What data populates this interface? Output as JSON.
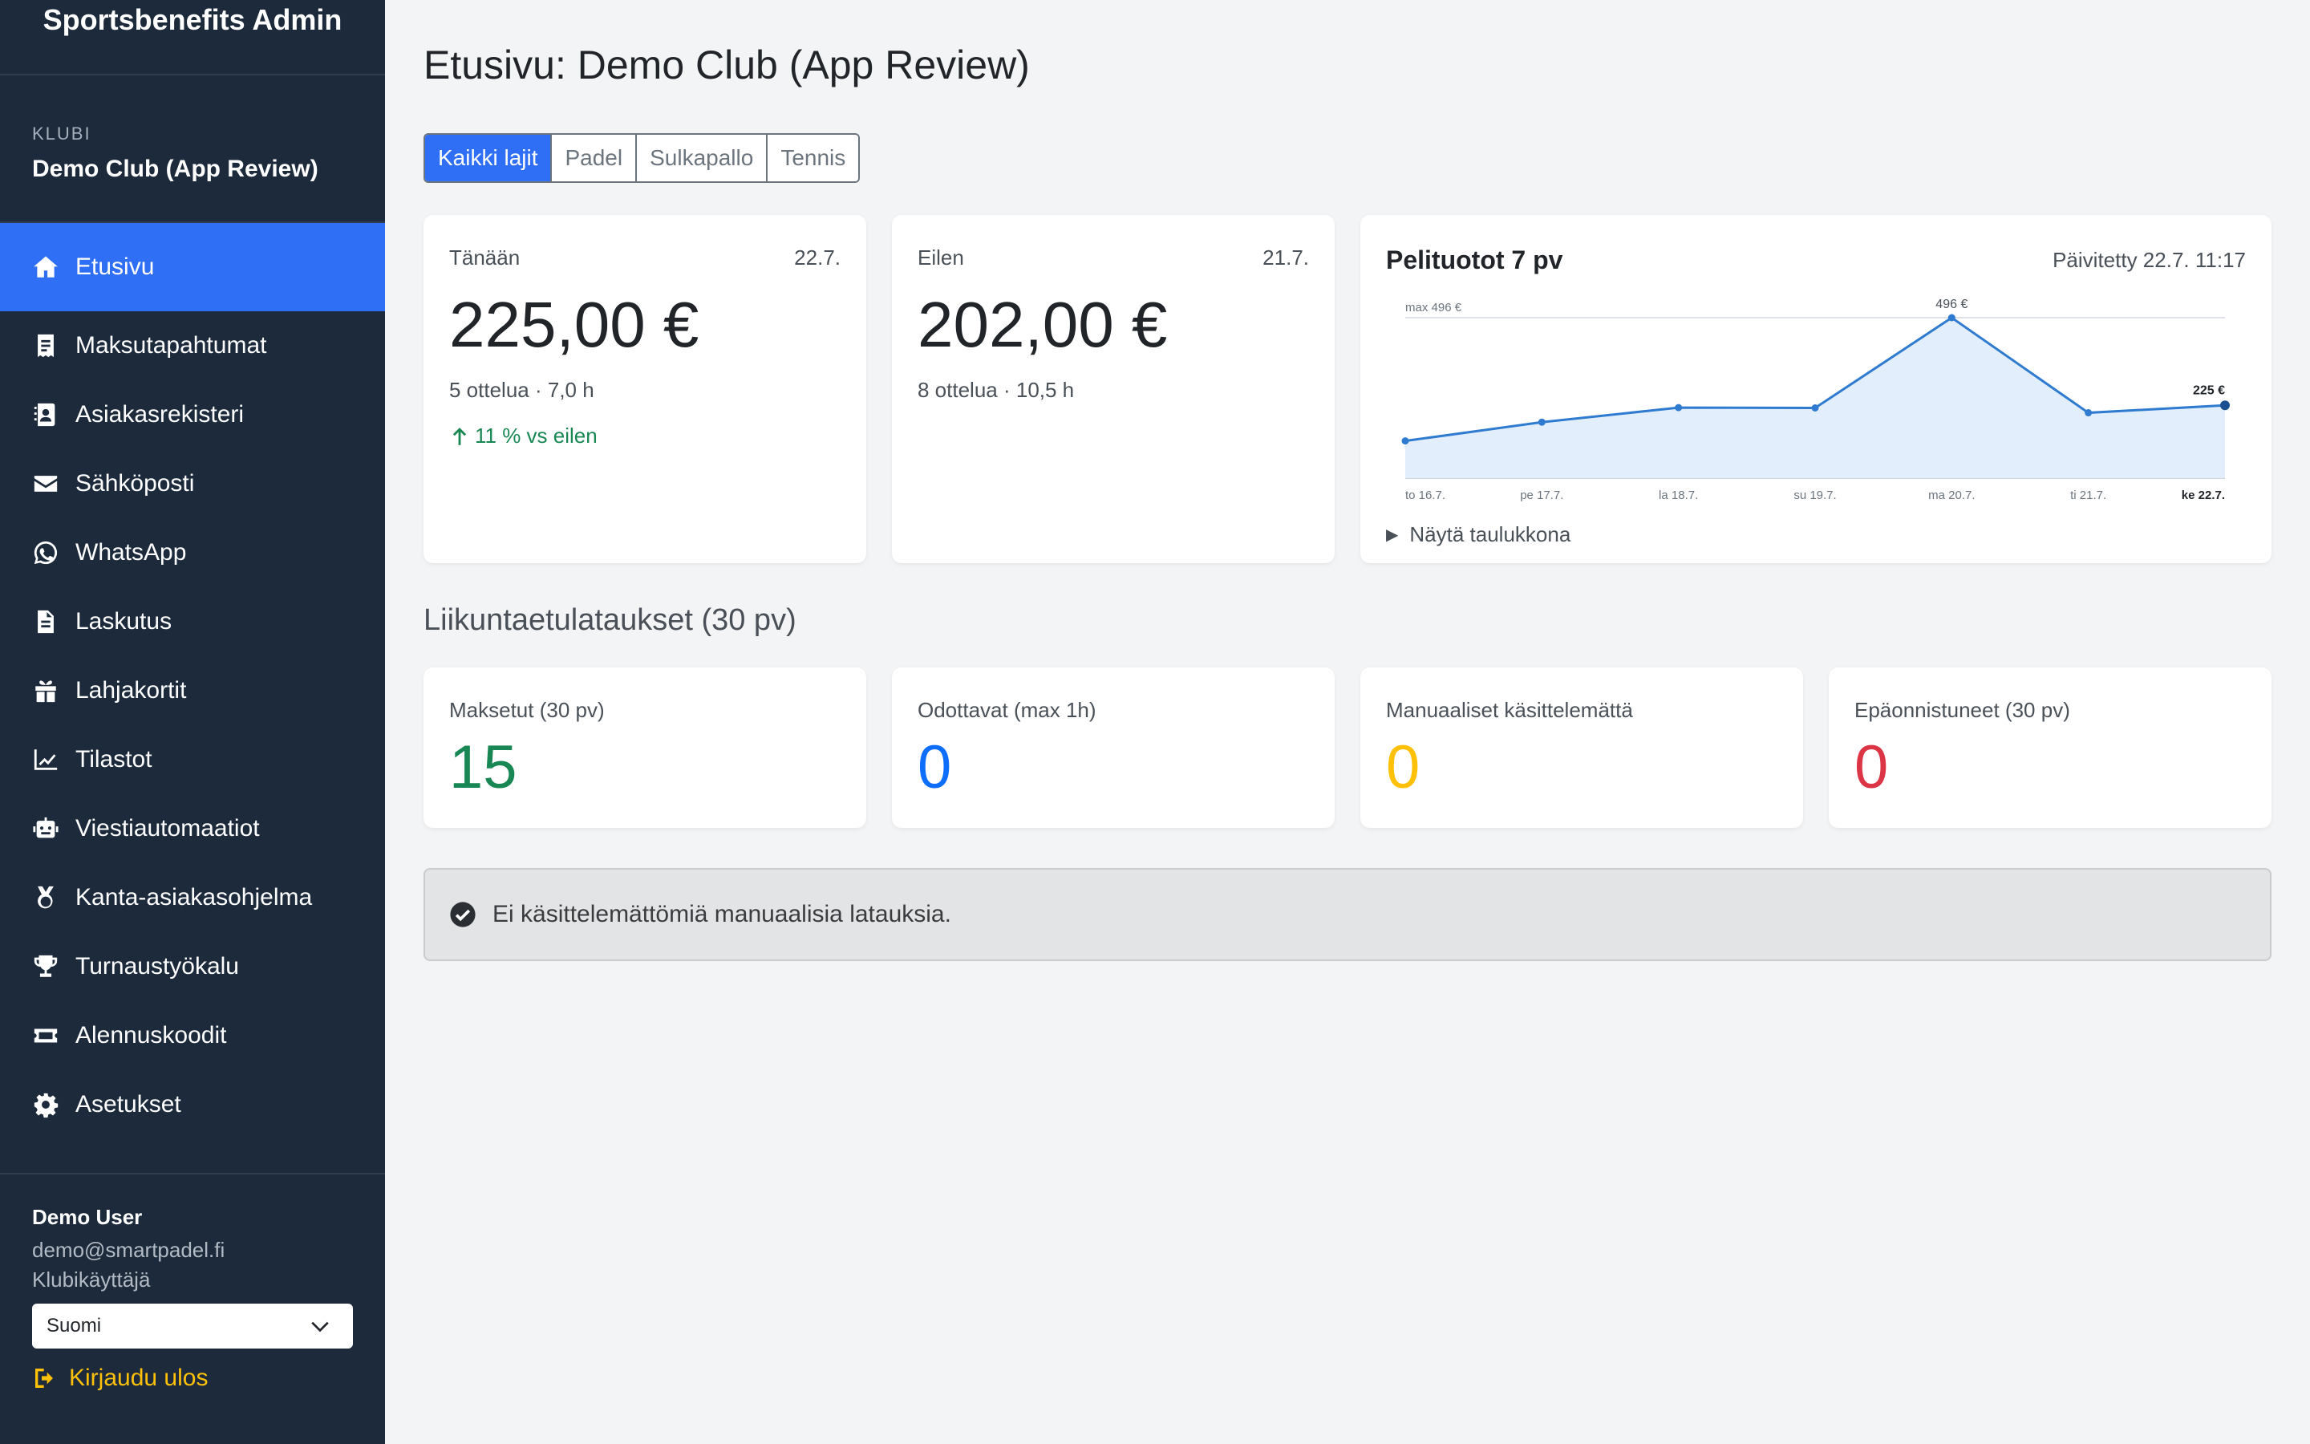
{
  "app": {
    "title": "Sportsbenefits Admin"
  },
  "club": {
    "caption": "KLUBI",
    "name": "Demo Club (App Review)"
  },
  "nav": [
    {
      "label": "Etusivu",
      "icon": "home-icon",
      "active": true
    },
    {
      "label": "Maksutapahtumat",
      "icon": "receipt-icon"
    },
    {
      "label": "Asiakasrekisteri",
      "icon": "contact-book-icon"
    },
    {
      "label": "Sähköposti",
      "icon": "envelope-icon"
    },
    {
      "label": "WhatsApp",
      "icon": "whatsapp-icon"
    },
    {
      "label": "Laskutus",
      "icon": "document-icon"
    },
    {
      "label": "Lahjakortit",
      "icon": "gift-icon"
    },
    {
      "label": "Tilastot",
      "icon": "line-chart-icon"
    },
    {
      "label": "Viestiautomaatiot",
      "icon": "robot-icon"
    },
    {
      "label": "Kanta-asiakasohjelma",
      "icon": "medal-icon"
    },
    {
      "label": "Turnaustyökalu",
      "icon": "trophy-icon"
    },
    {
      "label": "Alennuskoodit",
      "icon": "ticket-icon"
    },
    {
      "label": "Asetukset",
      "icon": "gear-icon"
    }
  ],
  "user": {
    "name": "Demo User",
    "email": "demo@smartpadel.fi",
    "role": "Klubikäyttäjä",
    "language": "Suomi",
    "logout": "Kirjaudu ulos"
  },
  "page": {
    "title": "Etusivu: Demo Club (App Review)"
  },
  "sport_tabs": [
    {
      "label": "Kaikki lajit",
      "active": true
    },
    {
      "label": "Padel"
    },
    {
      "label": "Sulkapallo"
    },
    {
      "label": "Tennis"
    }
  ],
  "today": {
    "label": "Tänään",
    "date": "22.7.",
    "amount": "225,00 €",
    "meta": "5 ottelua · 7,0 h",
    "trend": "11 % vs eilen"
  },
  "yesterday": {
    "label": "Eilen",
    "date": "21.7.",
    "amount": "202,00 €",
    "meta": "8 ottelua · 10,5 h"
  },
  "revenue_chart": {
    "title": "Pelituotot 7 pv",
    "updated": "Päivitetty 22.7. 11:17",
    "toggle": "Näytä taulukkona",
    "max_label": "max 496 €",
    "peak_label": "496 €",
    "last_label": "225 €"
  },
  "chart_data": {
    "type": "area",
    "title": "Pelituotot 7 pv",
    "categories": [
      "to 16.7.",
      "pe 17.7.",
      "la 18.7.",
      "su 19.7.",
      "ma 20.7.",
      "ti 21.7.",
      "ke 22.7."
    ],
    "values": [
      115,
      173,
      218,
      217,
      496,
      202,
      225
    ],
    "ylim": [
      0,
      496
    ]
  },
  "section": {
    "title": "Liikuntaetulataukset (30 pv)"
  },
  "stats": [
    {
      "label": "Maksetut (30 pv)",
      "value": "15",
      "color": "#198754"
    },
    {
      "label": "Odottavat (max 1h)",
      "value": "0",
      "color": "#0d6efd"
    },
    {
      "label": "Manuaaliset käsittelemättä",
      "value": "0",
      "color": "#ffc107"
    },
    {
      "label": "Epäonnistuneet (30 pv)",
      "value": "0",
      "color": "#dc3545"
    }
  ],
  "alert": {
    "text": "Ei käsittelemättömiä manuaalisia latauksia."
  }
}
